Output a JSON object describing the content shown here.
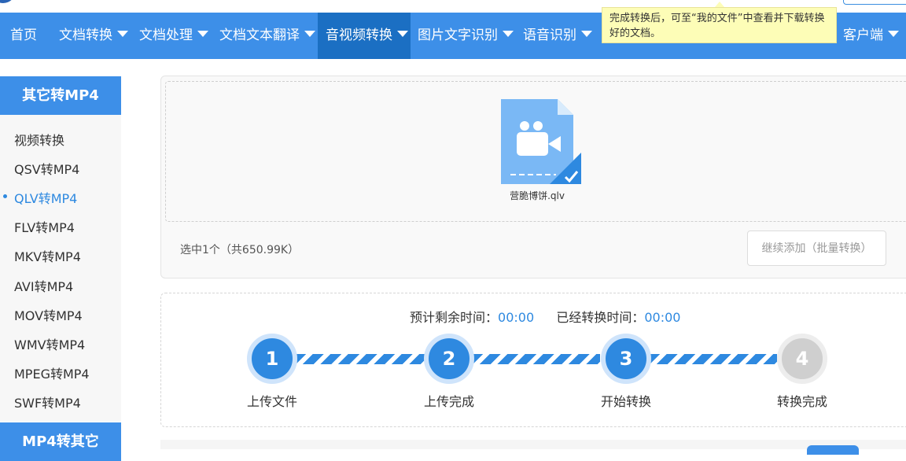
{
  "nav": {
    "items": [
      {
        "label": "首页"
      },
      {
        "label": "文档转换"
      },
      {
        "label": "文档处理"
      },
      {
        "label": "文档文本翻译"
      },
      {
        "label": "音视频转换"
      },
      {
        "label": "图片文字识别"
      },
      {
        "label": "语音识别"
      },
      {
        "label": "客户端"
      }
    ]
  },
  "tooltip": {
    "text": "完成转换后，可至“我的文件”中查看并下载转换好的文档。"
  },
  "sidebar": {
    "heading": "其它转MP4",
    "items": [
      {
        "label": "视频转换"
      },
      {
        "label": "QSV转MP4"
      },
      {
        "label": "QLV转MP4"
      },
      {
        "label": "FLV转MP4"
      },
      {
        "label": "MKV转MP4"
      },
      {
        "label": "AVI转MP4"
      },
      {
        "label": "MOV转MP4"
      },
      {
        "label": "WMV转MP4"
      },
      {
        "label": "MPEG转MP4"
      },
      {
        "label": "SWF转MP4"
      }
    ],
    "heading2": "MP4转其它"
  },
  "upload": {
    "file_name": "营脆博饼.qlv",
    "selected_summary": "选中1个（共650.99K）",
    "add_more_label": "继续添加（批量转换）"
  },
  "progress": {
    "remaining_label": "预计剩余时间：",
    "remaining_value": "00:00",
    "elapsed_label": "已经转换时间：",
    "elapsed_value": "00:00",
    "steps": [
      {
        "number": "1",
        "label": "上传文件"
      },
      {
        "number": "2",
        "label": "上传完成"
      },
      {
        "number": "3",
        "label": "开始转换"
      },
      {
        "number": "4",
        "label": "转换完成"
      }
    ]
  },
  "colors": {
    "brand": "#3d8fe8",
    "nav_active": "#1b6fc3",
    "accent": "#2e89e0",
    "tooltip_bg": "#fdfdb7"
  }
}
